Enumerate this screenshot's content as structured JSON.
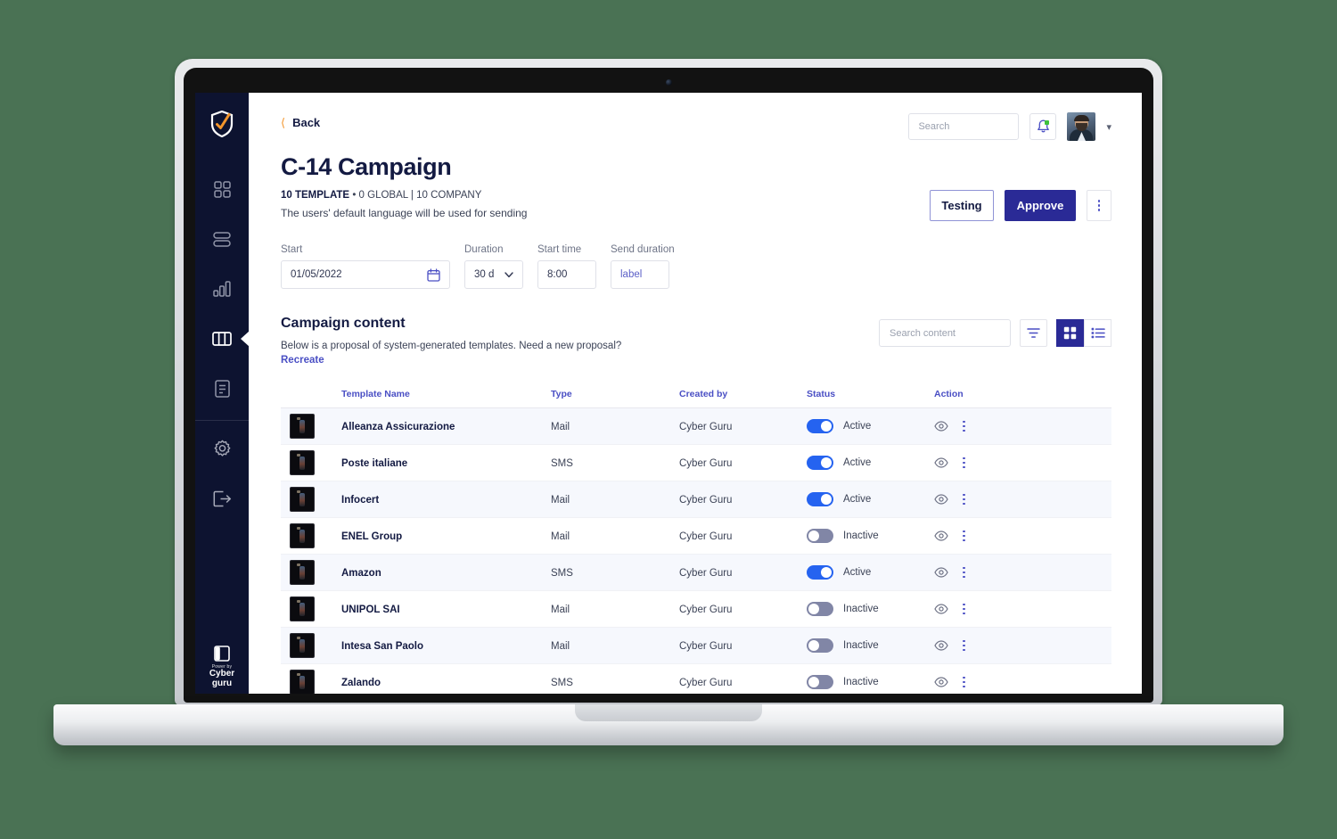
{
  "sidebar": {
    "logo_icon": "shield-check-logo",
    "items": [
      {
        "id": "dashboard",
        "icon": "dashboard-grid-icon",
        "active": false
      },
      {
        "id": "layers",
        "icon": "layers-stack-icon",
        "active": false
      },
      {
        "id": "analytics",
        "icon": "bar-chart-icon",
        "active": false
      },
      {
        "id": "campaigns",
        "icon": "columns-icon",
        "active": true
      },
      {
        "id": "reports",
        "icon": "document-icon",
        "active": false
      }
    ],
    "secondary_items": [
      {
        "id": "settings",
        "icon": "gear-icon",
        "active": false
      },
      {
        "id": "logout",
        "icon": "logout-icon",
        "active": false
      }
    ],
    "collapse_icon": "panel-collapse-icon",
    "brand": {
      "powered_by": "Power by",
      "name_line1": "Cyber",
      "name_line2": "guru"
    }
  },
  "header": {
    "back_label": "Back",
    "back_icon": "chevron-left-icon",
    "search": {
      "placeholder": "Search",
      "value": "",
      "icon": "search-icon"
    },
    "notifications": {
      "icon": "bell-icon",
      "has_badge": true,
      "badge_color": "#3ec13e"
    },
    "avatar": {
      "icon": "user-avatar",
      "caret_icon": "chevron-down-icon"
    }
  },
  "page": {
    "title": "C-14 Campaign",
    "meta_count": "10 TEMPLATE",
    "meta_separator": "•",
    "meta_detail": "0 GLOBAL | 10 COMPANY",
    "description": "The users' default language will be used for sending"
  },
  "actions": {
    "testing_label": "Testing",
    "approve_label": "Approve",
    "more_icon": "kebab-menu-icon"
  },
  "form": {
    "start": {
      "label": "Start",
      "value": "01/05/2022",
      "icon": "calendar-icon"
    },
    "duration": {
      "label": "Duration",
      "value": "30 d",
      "icon": "chevron-down-icon"
    },
    "start_time": {
      "label": "Start time",
      "value": "8:00"
    },
    "send_duration": {
      "label": "Send duration",
      "value": "label"
    }
  },
  "campaign_content": {
    "title": "Campaign content",
    "subtitle": "Below is a proposal of system-generated templates. Need a new proposal?",
    "recreate_link": "Recreate",
    "search": {
      "placeholder": "Search content",
      "value": "",
      "icon": "search-icon"
    },
    "filter_icon": "filter-icon",
    "grid_view_icon": "grid-view-icon",
    "list_view_icon": "list-view-icon",
    "active_view": "grid"
  },
  "table": {
    "columns": [
      "Template Name",
      "Type",
      "Created by",
      "Status",
      "Action"
    ],
    "rows": [
      {
        "name": "Alleanza Assicurazione",
        "type": "Mail",
        "created_by": "Cyber Guru",
        "status": "Active",
        "active": true
      },
      {
        "name": "Poste italiane",
        "type": "SMS",
        "created_by": "Cyber Guru",
        "status": "Active",
        "active": true
      },
      {
        "name": "Infocert",
        "type": "Mail",
        "created_by": "Cyber Guru",
        "status": "Active",
        "active": true
      },
      {
        "name": "ENEL Group",
        "type": "Mail",
        "created_by": "Cyber Guru",
        "status": "Inactive",
        "active": false
      },
      {
        "name": "Amazon",
        "type": "SMS",
        "created_by": "Cyber Guru",
        "status": "Active",
        "active": true
      },
      {
        "name": "UNIPOL SAI",
        "type": "Mail",
        "created_by": "Cyber Guru",
        "status": "Inactive",
        "active": false
      },
      {
        "name": "Intesa San Paolo",
        "type": "Mail",
        "created_by": "Cyber Guru",
        "status": "Inactive",
        "active": false
      },
      {
        "name": "Zalando",
        "type": "SMS",
        "created_by": "Cyber Guru",
        "status": "Inactive",
        "active": false
      }
    ],
    "row_icons": {
      "preview": "eye-icon",
      "more": "kebab-menu-icon",
      "thumbnail": "template-thumbnail"
    }
  },
  "colors": {
    "background": "#4a7254",
    "sidebar": "#0d1330",
    "primary": "#2a2a96",
    "accent_orange": "#f3952b",
    "link": "#4a4fc4",
    "toggle_on": "#2563f0",
    "toggle_off": "#8186a6",
    "row_alt": "#f6f8fd"
  }
}
